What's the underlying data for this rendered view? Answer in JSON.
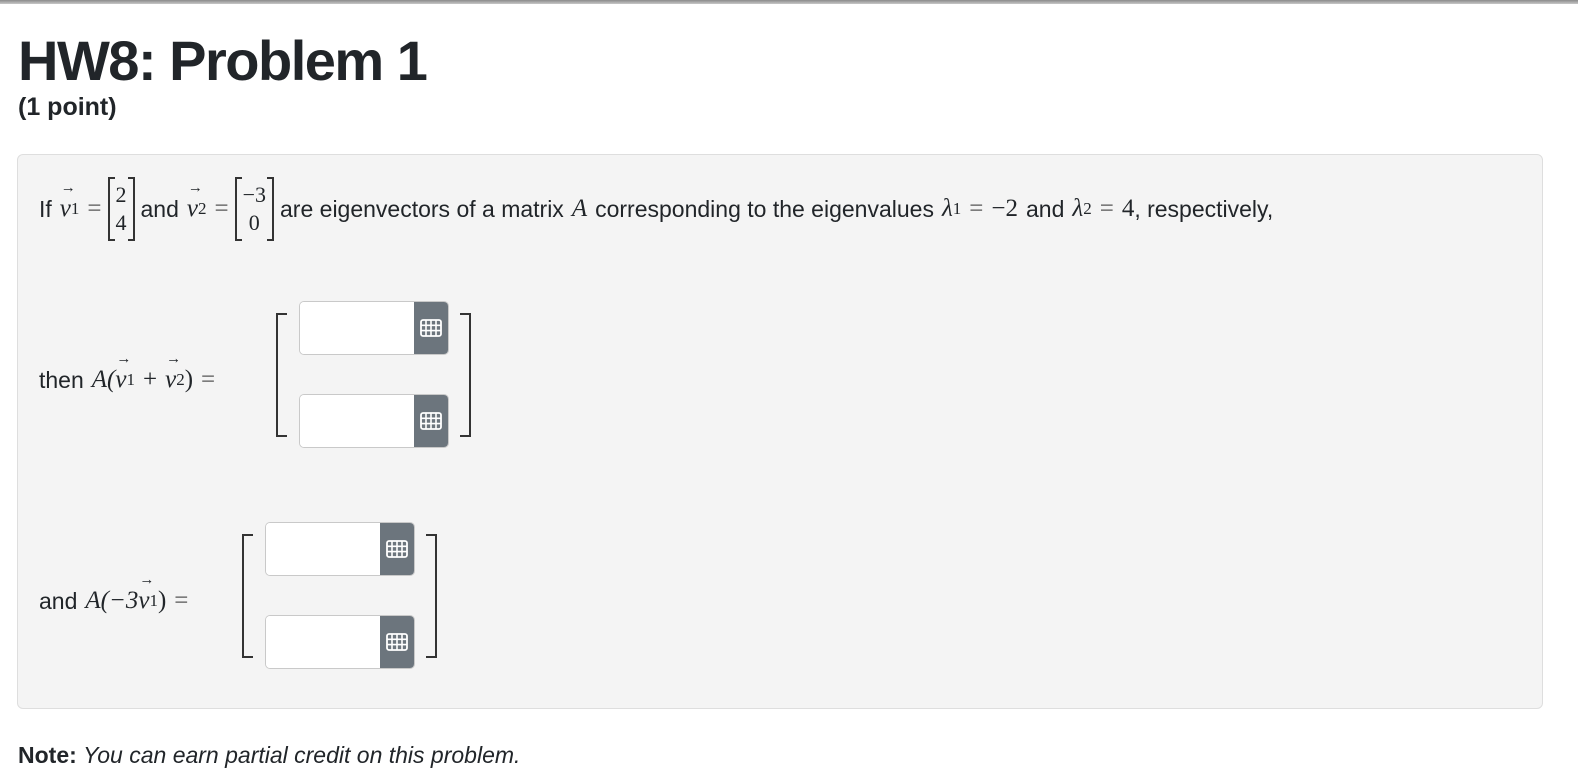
{
  "header": {
    "title": "HW8: Problem 1",
    "points": "(1 point)"
  },
  "problem": {
    "intro_if": "If",
    "v1_name": "v",
    "v1_sub": "1",
    "v1_entries": [
      "2",
      "4"
    ],
    "and_word": "and",
    "v2_name": "v",
    "v2_sub": "2",
    "v2_entries": [
      "−3",
      "0"
    ],
    "eq": "=",
    "middle_text": "are eigenvectors of a matrix",
    "matrix_name": "A",
    "corr_text": "corresponding to the eigenvalues",
    "lambda": "λ",
    "lambda1_sub": "1",
    "lambda1_val": "−2",
    "lambda2_sub": "2",
    "lambda2_val": "4",
    "respectively": ", respectively,",
    "then_word": "then",
    "expr1": "A(",
    "expr1_plus": "+",
    "expr1_close": ")",
    "and2_word": "and",
    "expr2_open": "A(−3",
    "expr2_close": ")"
  },
  "answers": {
    "a1_row1": "",
    "a1_row2": "",
    "a2_row1": "",
    "a2_row2": "",
    "button_icon": "matrix-grid-icon"
  },
  "note": {
    "label": "Note:",
    "text": "You can earn partial credit on this problem."
  }
}
